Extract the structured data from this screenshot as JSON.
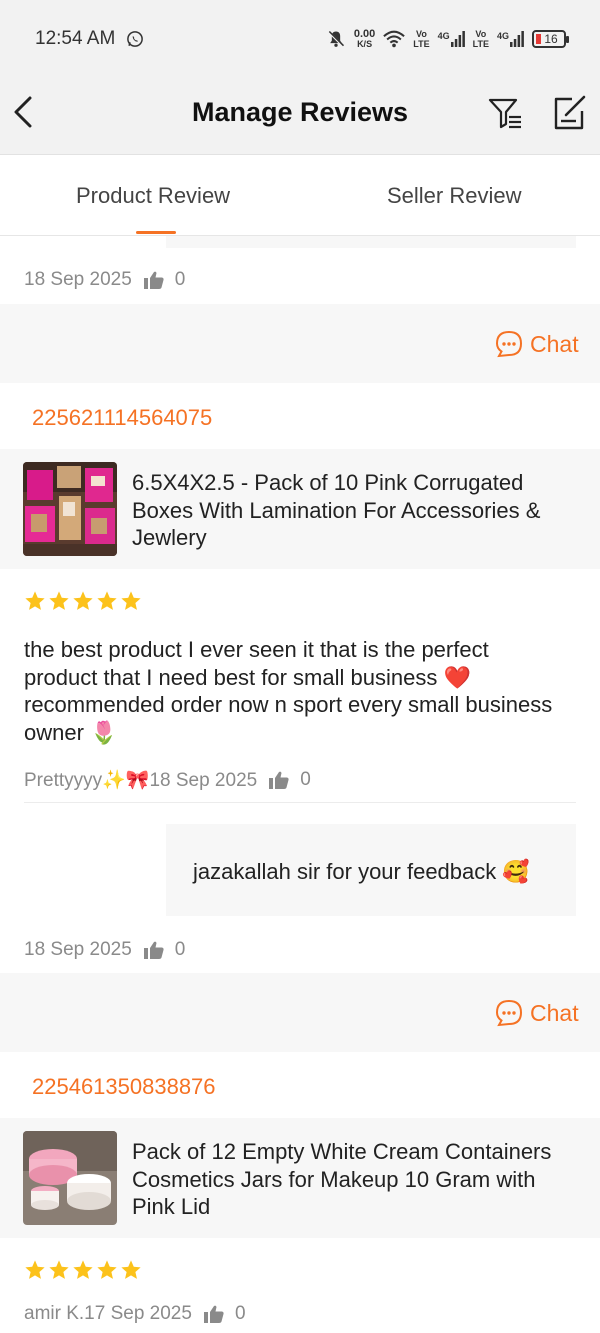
{
  "status_bar": {
    "time": "12:54 AM",
    "net_speed": "0.00",
    "net_unit": "K/S",
    "sim1_top": "Vo",
    "sim1_bottom": "LTE",
    "sim1_gen": "4G",
    "sim2_top": "Vo",
    "sim2_bottom": "LTE",
    "sim2_gen": "4G",
    "battery": "16"
  },
  "header": {
    "title": "Manage Reviews"
  },
  "tabs": [
    {
      "label": "Product Review",
      "active": true
    },
    {
      "label": "Seller Review",
      "active": false
    }
  ],
  "accent_color": "#f57224",
  "top_partial": {
    "date": "18 Sep 2025",
    "likes": "0"
  },
  "chat_label": "Chat",
  "orders": [
    {
      "order_id": "225621114564075",
      "product_name": "6.5X4X2.5 - Pack of 10 Pink Corrugated Boxes With Lamination For Accessories & Jewlery",
      "rating": 5,
      "review_text": "the best product I ever seen it that is the perfect product that I need best for small business ❤️ recommended order now n sport every small business owner 🌷",
      "reviewer_and_date": "Prettyyyy✨🎀18 Sep 2025",
      "likes": "0",
      "seller_reply": "jazakallah sir for your feedback 🥰",
      "reply_date": "18 Sep 2025",
      "reply_likes": "0"
    },
    {
      "order_id": "225461350838876",
      "product_name": "Pack of 12 Empty White Cream Containers Cosmetics Jars for Makeup 10 Gram with Pink Lid",
      "rating": 5,
      "reviewer_and_date": "amir K.17 Sep 2025",
      "likes": "0"
    }
  ]
}
